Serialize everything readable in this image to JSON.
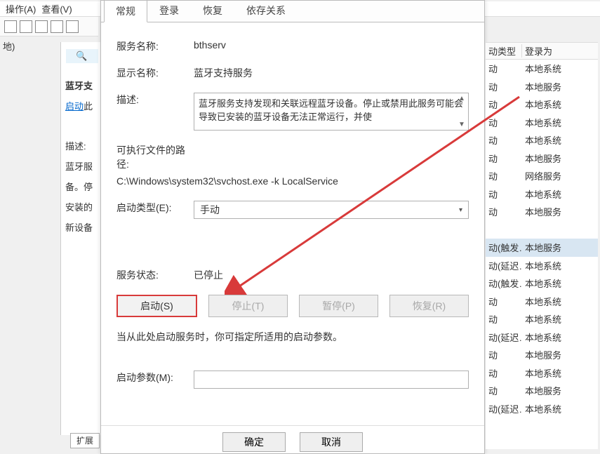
{
  "menu": {
    "file": "操作(A)",
    "view": "查看(V)"
  },
  "left_stub": "地)",
  "mid": {
    "title": "蓝牙支",
    "start_link": "启动",
    "start_suffix": "此",
    "desc_label": "描述:",
    "desc_l1": "蓝牙服",
    "desc_l2": "备。停",
    "desc_l3": "安装的",
    "desc_l4": "新设备"
  },
  "ext_tab": "扩展",
  "tabs": {
    "general": "常规",
    "logon": "登录",
    "recovery": "恢复",
    "deps": "依存关系"
  },
  "labels": {
    "service_name": "服务名称:",
    "display_name": "显示名称:",
    "description": "描述:",
    "exe_path": "可执行文件的路径:",
    "startup_type": "启动类型(E):",
    "service_status": "服务状态:",
    "start_params": "启动参数(M):"
  },
  "values": {
    "service_name": "bthserv",
    "display_name": "蓝牙支持服务",
    "description": "蓝牙服务支持发现和关联远程蓝牙设备。停止或禁用此服务可能会导致已安装的蓝牙设备无法正常运行，并使",
    "exe_path": "C:\\Windows\\system32\\svchost.exe -k LocalService",
    "startup_type": "手动",
    "service_status": "已停止",
    "hint": "当从此处启动服务时，你可指定所适用的启动参数。"
  },
  "buttons": {
    "start": "启动(S)",
    "stop": "停止(T)",
    "pause": "暂停(P)",
    "resume": "恢复(R)",
    "ok": "确定",
    "cancel": "取消"
  },
  "rlist": {
    "hdr_type": "动类型",
    "hdr_logon": "登录为",
    "rows": [
      {
        "t": "动",
        "l": "本地系统"
      },
      {
        "t": "动",
        "l": "本地服务"
      },
      {
        "t": "动",
        "l": "本地系统"
      },
      {
        "t": "动",
        "l": "本地系统"
      },
      {
        "t": "动",
        "l": "本地系统"
      },
      {
        "t": "动",
        "l": "本地服务"
      },
      {
        "t": "动",
        "l": "网络服务"
      },
      {
        "t": "动",
        "l": "本地系统"
      },
      {
        "t": "动",
        "l": "本地服务"
      },
      {
        "t": "",
        "l": ""
      },
      {
        "t": "动(触发…",
        "l": "本地服务",
        "sel": true
      },
      {
        "t": "动(延迟…",
        "l": "本地系统"
      },
      {
        "t": "动(触发…",
        "l": "本地系统"
      },
      {
        "t": "动",
        "l": "本地系统"
      },
      {
        "t": "动",
        "l": "本地系统"
      },
      {
        "t": "动(延迟…",
        "l": "本地系统"
      },
      {
        "t": "动",
        "l": "本地服务"
      },
      {
        "t": "动",
        "l": "本地系统"
      },
      {
        "t": "动",
        "l": "本地服务"
      },
      {
        "t": "动(延迟…",
        "l": "本地系统"
      }
    ]
  }
}
